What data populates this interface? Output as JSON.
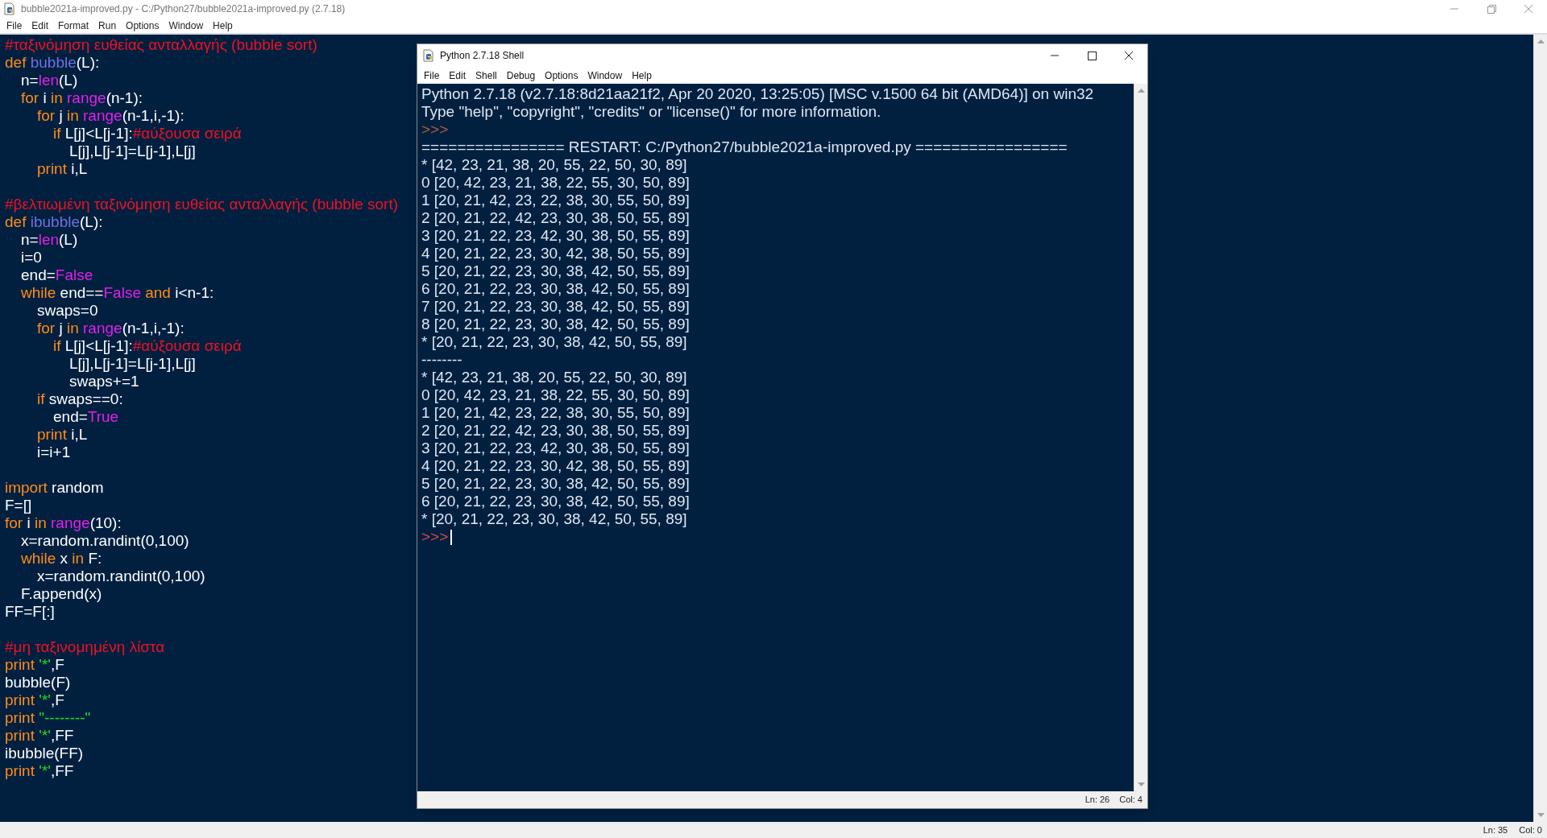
{
  "editor_window": {
    "title": "bubble2021a-improved.py - C:/Python27/bubble2021a-improved.py (2.7.18)",
    "menu": [
      "File",
      "Edit",
      "Format",
      "Run",
      "Options",
      "Window",
      "Help"
    ],
    "code_blocks": [
      [
        {
          "segments": [
            {
              "kind": "comment",
              "text": "#ταξινόμηση ευθείας ανταλλαγής (bubble sort)"
            }
          ]
        },
        {
          "segments": [
            {
              "kind": "keyword",
              "text": "def "
            },
            {
              "kind": "defname",
              "text": "bubble"
            },
            {
              "kind": "plain",
              "text": "(L):"
            }
          ],
          "children": [
            {
              "segments": [
                {
                  "kind": "plain",
                  "text": "n="
                },
                {
                  "kind": "builtin",
                  "text": "len"
                },
                {
                  "kind": "plain",
                  "text": "(L)"
                }
              ]
            },
            {
              "segments": [
                {
                  "kind": "keyword",
                  "text": "for "
                },
                {
                  "kind": "plain",
                  "text": "i "
                },
                {
                  "kind": "keyword",
                  "text": "in "
                },
                {
                  "kind": "builtin",
                  "text": "range"
                },
                {
                  "kind": "plain",
                  "text": "(n-1):"
                }
              ],
              "children": [
                {
                  "segments": [
                    {
                      "kind": "keyword",
                      "text": "for "
                    },
                    {
                      "kind": "plain",
                      "text": "j "
                    },
                    {
                      "kind": "keyword",
                      "text": "in "
                    },
                    {
                      "kind": "builtin",
                      "text": "range"
                    },
                    {
                      "kind": "plain",
                      "text": "(n-1,i,-1):"
                    }
                  ],
                  "children": [
                    {
                      "segments": [
                        {
                          "kind": "keyword",
                          "text": "if "
                        },
                        {
                          "kind": "plain",
                          "text": "L[j]<L[j-1]:"
                        },
                        {
                          "kind": "comment",
                          "text": "#αύξουσα σειρά"
                        }
                      ],
                      "children": [
                        {
                          "segments": [
                            {
                              "kind": "plain",
                              "text": "L[j],L[j-1]=L[j-1],L[j]"
                            }
                          ]
                        }
                      ]
                    }
                  ]
                },
                {
                  "segments": [
                    {
                      "kind": "keyword",
                      "text": "print "
                    },
                    {
                      "kind": "plain",
                      "text": "i,L"
                    }
                  ]
                }
              ]
            }
          ]
        }
      ],
      [
        {
          "segments": [
            {
              "kind": "comment",
              "text": "#βελτιωμένη ταξινόμηση ευθείας ανταλλαγής (bubble sort)"
            }
          ]
        },
        {
          "segments": [
            {
              "kind": "keyword",
              "text": "def "
            },
            {
              "kind": "defname",
              "text": "ibubble"
            },
            {
              "kind": "plain",
              "text": "(L):"
            }
          ],
          "children": [
            {
              "segments": [
                {
                  "kind": "plain",
                  "text": "n="
                },
                {
                  "kind": "builtin",
                  "text": "len"
                },
                {
                  "kind": "plain",
                  "text": "(L)"
                }
              ]
            },
            {
              "segments": [
                {
                  "kind": "plain",
                  "text": "i=0"
                }
              ]
            },
            {
              "segments": [
                {
                  "kind": "plain",
                  "text": "end="
                },
                {
                  "kind": "builtin",
                  "text": "False"
                }
              ]
            },
            {
              "segments": [
                {
                  "kind": "keyword",
                  "text": "while "
                },
                {
                  "kind": "plain",
                  "text": "end=="
                },
                {
                  "kind": "builtin",
                  "text": "False"
                },
                {
                  "kind": "keyword",
                  "text": " and "
                },
                {
                  "kind": "plain",
                  "text": "i<n-1:"
                }
              ],
              "children": [
                {
                  "segments": [
                    {
                      "kind": "plain",
                      "text": "swaps=0"
                    }
                  ]
                },
                {
                  "segments": [
                    {
                      "kind": "keyword",
                      "text": "for "
                    },
                    {
                      "kind": "plain",
                      "text": "j "
                    },
                    {
                      "kind": "keyword",
                      "text": "in "
                    },
                    {
                      "kind": "builtin",
                      "text": "range"
                    },
                    {
                      "kind": "plain",
                      "text": "(n-1,i,-1):"
                    }
                  ],
                  "children": [
                    {
                      "segments": [
                        {
                          "kind": "keyword",
                          "text": "if "
                        },
                        {
                          "kind": "plain",
                          "text": "L[j]<L[j-1]:"
                        },
                        {
                          "kind": "comment",
                          "text": "#αύξουσα σειρά"
                        }
                      ],
                      "children": [
                        {
                          "segments": [
                            {
                              "kind": "plain",
                              "text": "L[j],L[j-1]=L[j-1],L[j]"
                            }
                          ]
                        },
                        {
                          "segments": [
                            {
                              "kind": "plain",
                              "text": "swaps+=1"
                            }
                          ]
                        }
                      ]
                    }
                  ]
                },
                {
                  "segments": [
                    {
                      "kind": "keyword",
                      "text": "if "
                    },
                    {
                      "kind": "plain",
                      "text": "swaps==0:"
                    }
                  ],
                  "children": [
                    {
                      "segments": [
                        {
                          "kind": "plain",
                          "text": "end="
                        },
                        {
                          "kind": "builtin",
                          "text": "True"
                        }
                      ]
                    }
                  ]
                },
                {
                  "segments": [
                    {
                      "kind": "keyword",
                      "text": "print "
                    },
                    {
                      "kind": "plain",
                      "text": "i,L"
                    }
                  ]
                },
                {
                  "segments": [
                    {
                      "kind": "plain",
                      "text": "i=i+1"
                    }
                  ]
                }
              ]
            }
          ]
        }
      ],
      [
        {
          "segments": [
            {
              "kind": "keyword",
              "text": "import "
            },
            {
              "kind": "plain",
              "text": "random"
            }
          ]
        },
        {
          "segments": [
            {
              "kind": "plain",
              "text": "F=[]"
            }
          ]
        },
        {
          "segments": [
            {
              "kind": "keyword",
              "text": "for "
            },
            {
              "kind": "plain",
              "text": "i "
            },
            {
              "kind": "keyword",
              "text": "in "
            },
            {
              "kind": "builtin",
              "text": "range"
            },
            {
              "kind": "plain",
              "text": "(10):"
            }
          ],
          "children": [
            {
              "segments": [
                {
                  "kind": "plain",
                  "text": "x=random.randint(0,100)"
                }
              ]
            },
            {
              "segments": [
                {
                  "kind": "keyword",
                  "text": "while "
                },
                {
                  "kind": "plain",
                  "text": "x "
                },
                {
                  "kind": "keyword",
                  "text": "in "
                },
                {
                  "kind": "plain",
                  "text": "F:"
                }
              ],
              "children": [
                {
                  "segments": [
                    {
                      "kind": "plain",
                      "text": "x=random.randint(0,100)"
                    }
                  ]
                }
              ]
            },
            {
              "segments": [
                {
                  "kind": "plain",
                  "text": "F.append(x)"
                }
              ]
            }
          ]
        },
        {
          "segments": [
            {
              "kind": "plain",
              "text": "FF=F[:]"
            }
          ]
        }
      ],
      [
        {
          "segments": [
            {
              "kind": "comment",
              "text": "#μη ταξινομημένη λίστα"
            }
          ]
        },
        {
          "segments": [
            {
              "kind": "keyword",
              "text": "print "
            },
            {
              "kind": "string",
              "text": "'*'"
            },
            {
              "kind": "plain",
              "text": ",F"
            }
          ]
        },
        {
          "segments": [
            {
              "kind": "plain",
              "text": "bubble(F)"
            }
          ]
        },
        {
          "segments": [
            {
              "kind": "keyword",
              "text": "print "
            },
            {
              "kind": "string",
              "text": "'*'"
            },
            {
              "kind": "plain",
              "text": ",F"
            }
          ]
        },
        {
          "segments": [
            {
              "kind": "keyword",
              "text": "print "
            },
            {
              "kind": "string",
              "text": "\"--------\""
            }
          ]
        },
        {
          "segments": [
            {
              "kind": "keyword",
              "text": "print "
            },
            {
              "kind": "string",
              "text": "'*'"
            },
            {
              "kind": "plain",
              "text": ",FF"
            }
          ]
        },
        {
          "segments": [
            {
              "kind": "plain",
              "text": "ibubble(FF)"
            }
          ]
        },
        {
          "segments": [
            {
              "kind": "keyword",
              "text": "print "
            },
            {
              "kind": "string",
              "text": "'*'"
            },
            {
              "kind": "plain",
              "text": ",FF"
            }
          ]
        }
      ]
    ],
    "status": {
      "line": "Ln: 35",
      "column": "Col: 0"
    }
  },
  "shell_window": {
    "title": "Python 2.7.18 Shell",
    "menu": [
      "File",
      "Edit",
      "Shell",
      "Debug",
      "Options",
      "Window",
      "Help"
    ],
    "lines": [
      {
        "kind": "output",
        "text": "Python 2.7.18 (v2.7.18:8d21aa21f2, Apr 20 2020, 13:25:05) [MSC v.1500 64 bit (AMD64)] on win32"
      },
      {
        "kind": "output",
        "text": "Type \"help\", \"copyright\", \"credits\" or \"license()\" for more information."
      },
      {
        "kind": "prompt",
        "text": ">>>",
        "active": false
      },
      {
        "kind": "output",
        "text": "================ RESTART: C:/Python27/bubble2021a-improved.py ================="
      },
      {
        "kind": "output",
        "text": "* [42, 23, 21, 38, 20, 55, 22, 50, 30, 89]"
      },
      {
        "kind": "output",
        "text": "0 [20, 42, 23, 21, 38, 22, 55, 30, 50, 89]"
      },
      {
        "kind": "output",
        "text": "1 [20, 21, 42, 23, 22, 38, 30, 55, 50, 89]"
      },
      {
        "kind": "output",
        "text": "2 [20, 21, 22, 42, 23, 30, 38, 50, 55, 89]"
      },
      {
        "kind": "output",
        "text": "3 [20, 21, 22, 23, 42, 30, 38, 50, 55, 89]"
      },
      {
        "kind": "output",
        "text": "4 [20, 21, 22, 23, 30, 42, 38, 50, 55, 89]"
      },
      {
        "kind": "output",
        "text": "5 [20, 21, 22, 23, 30, 38, 42, 50, 55, 89]"
      },
      {
        "kind": "output",
        "text": "6 [20, 21, 22, 23, 30, 38, 42, 50, 55, 89]"
      },
      {
        "kind": "output",
        "text": "7 [20, 21, 22, 23, 30, 38, 42, 50, 55, 89]"
      },
      {
        "kind": "output",
        "text": "8 [20, 21, 22, 23, 30, 38, 42, 50, 55, 89]"
      },
      {
        "kind": "output",
        "text": "* [20, 21, 22, 23, 30, 38, 42, 50, 55, 89]"
      },
      {
        "kind": "output",
        "text": "--------"
      },
      {
        "kind": "output",
        "text": "* [42, 23, 21, 38, 20, 55, 22, 50, 30, 89]"
      },
      {
        "kind": "output",
        "text": "0 [20, 42, 23, 21, 38, 22, 55, 30, 50, 89]"
      },
      {
        "kind": "output",
        "text": "1 [20, 21, 42, 23, 22, 38, 30, 55, 50, 89]"
      },
      {
        "kind": "output",
        "text": "2 [20, 21, 22, 42, 23, 30, 38, 50, 55, 89]"
      },
      {
        "kind": "output",
        "text": "3 [20, 21, 22, 23, 42, 30, 38, 50, 55, 89]"
      },
      {
        "kind": "output",
        "text": "4 [20, 21, 22, 23, 30, 42, 38, 50, 55, 89]"
      },
      {
        "kind": "output",
        "text": "5 [20, 21, 22, 23, 30, 38, 42, 50, 55, 89]"
      },
      {
        "kind": "output",
        "text": "6 [20, 21, 22, 23, 30, 38, 42, 50, 55, 89]"
      },
      {
        "kind": "output",
        "text": "* [20, 21, 22, 23, 30, 38, 42, 50, 55, 89]"
      },
      {
        "kind": "prompt",
        "text": ">>>",
        "active": true
      }
    ],
    "status": {
      "line": "Ln: 26",
      "column": "Col: 4"
    }
  }
}
